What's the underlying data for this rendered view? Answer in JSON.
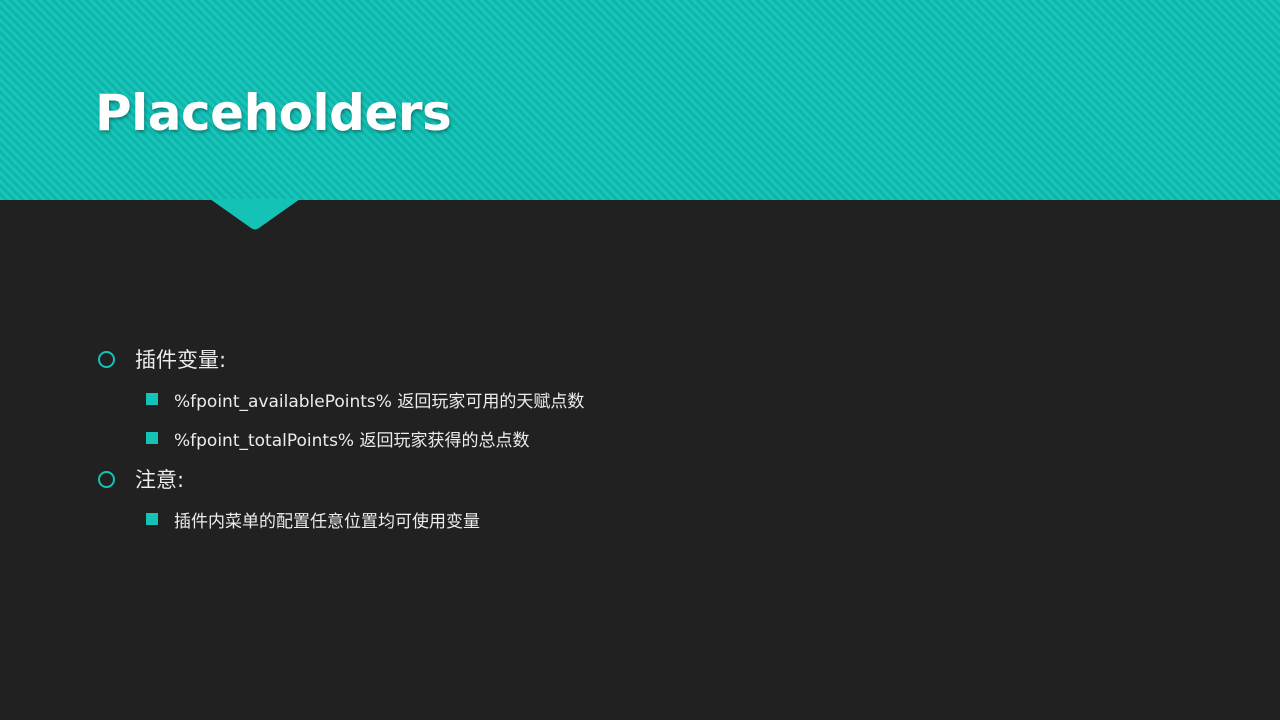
{
  "slide": {
    "title": "Placeholders",
    "accent_color": "#14c2b6",
    "background_color": "#212121",
    "bullets": [
      {
        "level": 1,
        "text": "插件变量:"
      },
      {
        "level": 2,
        "text": "%fpoint_availablePoints% 返回玩家可用的天赋点数"
      },
      {
        "level": 2,
        "text": "%fpoint_totalPoints% 返回玩家获得的总点数"
      },
      {
        "level": 1,
        "text": "注意:"
      },
      {
        "level": 2,
        "text": "插件内菜单的配置任意位置均可使用变量"
      }
    ]
  }
}
